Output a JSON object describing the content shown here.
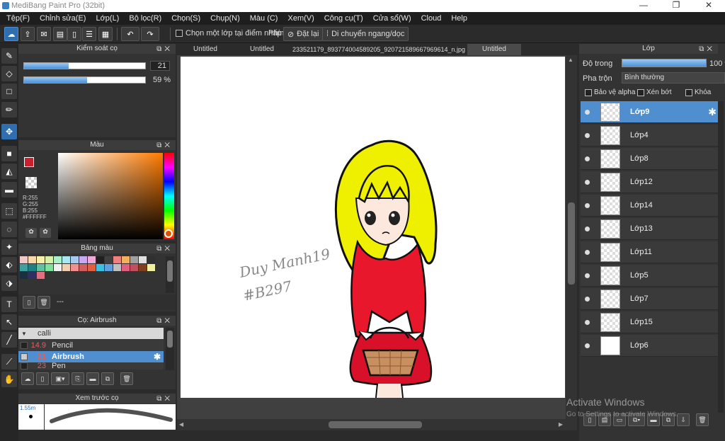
{
  "window": {
    "title": "MediBang Paint Pro (32bit)",
    "min": "—",
    "max": "❐",
    "close": "✕"
  },
  "menu": [
    "Tệp(F)",
    "Chỉnh sửa(E)",
    "Lớp(L)",
    "Bộ lọc(R)",
    "Chọn(S)",
    "Chụp(N)",
    "Màu (C)",
    "Xem(V)",
    "Công cụ(T)",
    "Cửa sổ(W)",
    "Cloud",
    "Help"
  ],
  "toolbar": {
    "select_one_layer": "Chọn một lớp tại điểm nhấp",
    "keys_label": "Phím",
    "reset": "Đặt lại",
    "move": "Di chuyển ngang/dọc"
  },
  "brush_control": {
    "title": "Kiểm soát cọ",
    "size": "21",
    "opacity": "59 %",
    "size_fraction": 0.37,
    "opacity_fraction": 0.52
  },
  "color": {
    "title": "Màu",
    "r": "R:255",
    "g": "G:255",
    "b": "B:255",
    "hex": "#FFFFFF",
    "primary": "#cc1f2e"
  },
  "palette": {
    "title": "Bảng màu",
    "colors": [
      "#f0c8c8",
      "#f8d8a8",
      "#f8f0a8",
      "#d8f0a8",
      "#a8f0c8",
      "#a8e8f0",
      "#a8c8f0",
      "#c8a8f0",
      "#f0a8d8",
      "#202020",
      "#404040",
      "#f08080",
      "#f0b060",
      "#a0a0a0",
      "#e0e0e0",
      "#303030",
      "#40a0a0",
      "#208080",
      "#60c0a0",
      "#80e0a0",
      "#f0f0f0",
      "#f0d0b0",
      "#f09090",
      "#d06060",
      "#e06040",
      "#40c0e0",
      "#60a0e0",
      "#c0c0c0",
      "#e06080",
      "#c05060",
      "#804020",
      "#f0f0a0",
      "#1a3040",
      "#303060",
      "#e07080"
    ],
    "footer": "---"
  },
  "brush_panel": {
    "title": "Cọ: Airbrush",
    "group": "calli",
    "items": [
      {
        "size": "14.9",
        "name": "Pencil"
      },
      {
        "size": "21",
        "name": "Airbrush"
      },
      {
        "size": "23",
        "name": "Pen"
      }
    ]
  },
  "preview": {
    "title": "Xem trước cọ",
    "size_label": "1.55m"
  },
  "tabs": [
    "Untitled",
    "Untitled",
    "233521179_893774004589205_920721589667969614_n.jpg",
    "Untitled"
  ],
  "canvas": {
    "signature_line1": "Duy Manh19",
    "signature_line2": "#B297"
  },
  "layers_panel": {
    "title": "Lớp",
    "opacity_label": "Độ trong",
    "opacity_value": "100 %",
    "blend_label": "Pha trộn",
    "blend_value": "Bình thường",
    "protect_alpha": "Bảo vệ alpha",
    "clipping": "Xén bớt",
    "lock": "Khóa",
    "layers": [
      {
        "name": "Lớp9"
      },
      {
        "name": "Lớp4"
      },
      {
        "name": "Lớp8"
      },
      {
        "name": "Lớp12"
      },
      {
        "name": "Lớp14"
      },
      {
        "name": "Lớp13"
      },
      {
        "name": "Lớp11"
      },
      {
        "name": "Lớp5"
      },
      {
        "name": "Lớp7"
      },
      {
        "name": "Lớp15"
      },
      {
        "name": "Lớp6"
      }
    ]
  },
  "watermark": {
    "line1": "Activate Windows",
    "line2": "Go to Settings to activate Windows."
  }
}
